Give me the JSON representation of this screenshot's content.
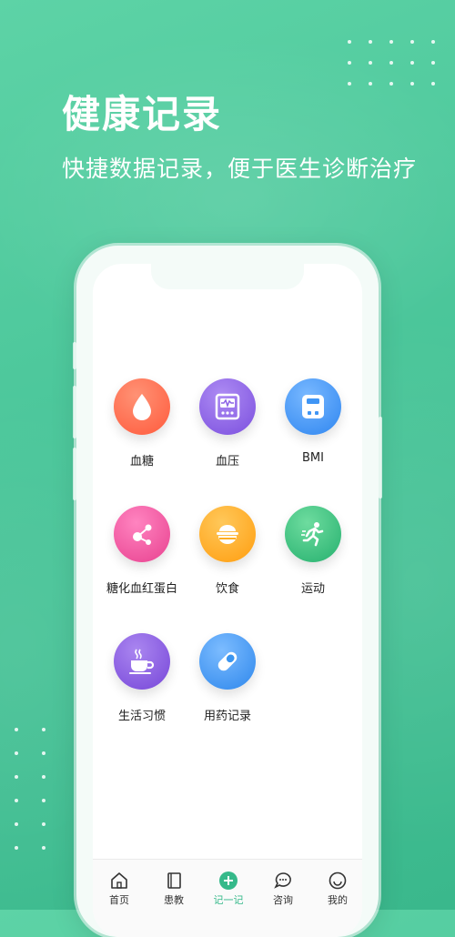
{
  "hero": {
    "title": "健康记录",
    "subtitle": "快捷数据记录，便于医生诊断治疗"
  },
  "records": [
    {
      "label": "血糖",
      "icon": "drop-icon",
      "color": "#ff6e4e"
    },
    {
      "label": "血压",
      "icon": "monitor-icon",
      "color": "#8c63e6"
    },
    {
      "label": "BMI",
      "icon": "scale-icon",
      "color": "#3f95f5"
    },
    {
      "label": "糖化血红蛋白",
      "icon": "molecule-icon",
      "color": "#f15aa6"
    },
    {
      "label": "饮食",
      "icon": "rice-bowl-icon",
      "color": "#ffae22"
    },
    {
      "label": "运动",
      "icon": "running-icon",
      "color": "#3bc386"
    },
    {
      "label": "生活习惯",
      "icon": "coffee-cup-icon",
      "color": "#8f5ce0"
    },
    {
      "label": "用药记录",
      "icon": "pill-icon",
      "color": "#3a95f0"
    }
  ],
  "tabs": [
    {
      "label": "首页",
      "icon": "home-icon"
    },
    {
      "label": "患教",
      "icon": "book-icon"
    },
    {
      "label": "记一记",
      "icon": "plus-circle-icon",
      "active": true
    },
    {
      "label": "咨询",
      "icon": "chat-icon"
    },
    {
      "label": "我的",
      "icon": "smile-icon"
    }
  ],
  "colors": {
    "brand_green": "#35b98a"
  }
}
